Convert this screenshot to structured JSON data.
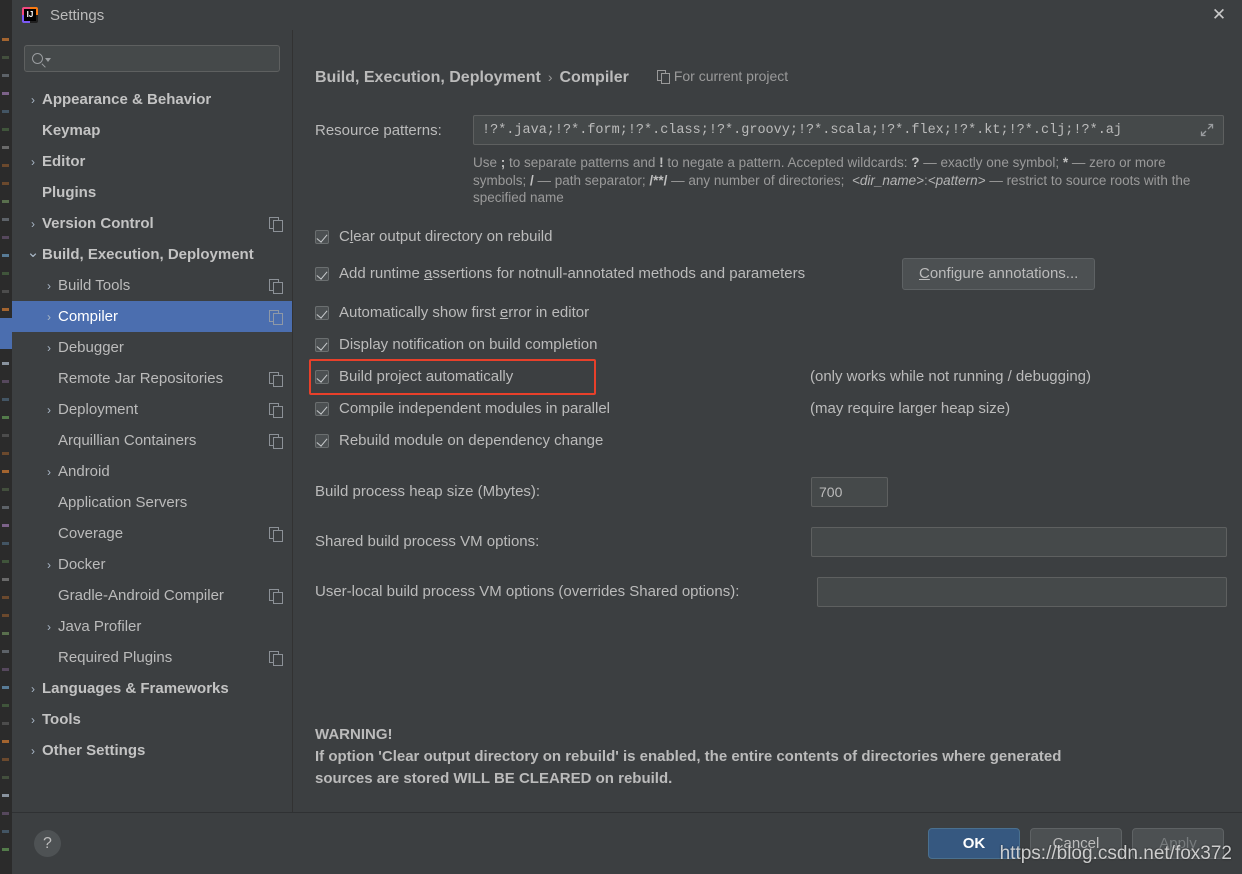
{
  "window": {
    "title": "Settings",
    "app_icon": "intellij-idea-logo",
    "close_label": "✕"
  },
  "sidebar": {
    "search": {
      "placeholder": "",
      "value": "",
      "icon": "search-icon"
    },
    "items": [
      {
        "label": "Appearance & Behavior",
        "arrow": "›",
        "bold": true,
        "indent": 0,
        "copy": false,
        "selected": false
      },
      {
        "label": "Keymap",
        "arrow": "",
        "bold": true,
        "indent": 0,
        "copy": false,
        "selected": false
      },
      {
        "label": "Editor",
        "arrow": "›",
        "bold": true,
        "indent": 0,
        "copy": false,
        "selected": false
      },
      {
        "label": "Plugins",
        "arrow": "",
        "bold": true,
        "indent": 0,
        "copy": false,
        "selected": false
      },
      {
        "label": "Version Control",
        "arrow": "›",
        "bold": true,
        "indent": 0,
        "copy": true,
        "selected": false
      },
      {
        "label": "Build, Execution, Deployment",
        "arrow": "⌄",
        "bold": true,
        "indent": 0,
        "copy": false,
        "selected": false
      },
      {
        "label": "Build Tools",
        "arrow": "›",
        "bold": false,
        "indent": 1,
        "copy": true,
        "selected": false
      },
      {
        "label": "Compiler",
        "arrow": "›",
        "bold": false,
        "indent": 1,
        "copy": true,
        "selected": true
      },
      {
        "label": "Debugger",
        "arrow": "›",
        "bold": false,
        "indent": 1,
        "copy": false,
        "selected": false
      },
      {
        "label": "Remote Jar Repositories",
        "arrow": "",
        "bold": false,
        "indent": 1,
        "copy": true,
        "selected": false
      },
      {
        "label": "Deployment",
        "arrow": "›",
        "bold": false,
        "indent": 1,
        "copy": true,
        "selected": false
      },
      {
        "label": "Arquillian Containers",
        "arrow": "",
        "bold": false,
        "indent": 1,
        "copy": true,
        "selected": false
      },
      {
        "label": "Android",
        "arrow": "›",
        "bold": false,
        "indent": 1,
        "copy": false,
        "selected": false
      },
      {
        "label": "Application Servers",
        "arrow": "",
        "bold": false,
        "indent": 1,
        "copy": false,
        "selected": false
      },
      {
        "label": "Coverage",
        "arrow": "",
        "bold": false,
        "indent": 1,
        "copy": true,
        "selected": false
      },
      {
        "label": "Docker",
        "arrow": "›",
        "bold": false,
        "indent": 1,
        "copy": false,
        "selected": false
      },
      {
        "label": "Gradle-Android Compiler",
        "arrow": "",
        "bold": false,
        "indent": 1,
        "copy": true,
        "selected": false
      },
      {
        "label": "Java Profiler",
        "arrow": "›",
        "bold": false,
        "indent": 1,
        "copy": false,
        "selected": false
      },
      {
        "label": "Required Plugins",
        "arrow": "",
        "bold": false,
        "indent": 1,
        "copy": true,
        "selected": false
      },
      {
        "label": "Languages & Frameworks",
        "arrow": "›",
        "bold": true,
        "indent": 0,
        "copy": false,
        "selected": false
      },
      {
        "label": "Tools",
        "arrow": "›",
        "bold": true,
        "indent": 0,
        "copy": false,
        "selected": false
      },
      {
        "label": "Other Settings",
        "arrow": "›",
        "bold": true,
        "indent": 0,
        "copy": false,
        "selected": false
      }
    ]
  },
  "content": {
    "breadcrumb": {
      "parent": "Build, Execution, Deployment",
      "separator": "›",
      "current": "Compiler",
      "scope": "For current project",
      "scope_icon": "project-scope-icon"
    },
    "resource_patterns": {
      "label": "Resource patterns:",
      "value": "!?*.java;!?*.form;!?*.class;!?*.groovy;!?*.scala;!?*.flex;!?*.kt;!?*.clj;!?*.aj",
      "expand_icon": "expand-editor-icon",
      "hint": "Use ; to separate patterns and ! to negate a pattern. Accepted wildcards: ? — exactly one symbol; * — zero or more symbols; / — path separator; /**/ — any number of directories; <dir_name>:<pattern> — restrict to source roots with the specified name"
    },
    "checkboxes": [
      {
        "label": "Clear output directory on rebuild",
        "checked": true,
        "note": "",
        "mnemonic": "l"
      },
      {
        "label": "Add runtime assertions for notnull-annotated methods and parameters",
        "checked": true,
        "note": "",
        "mnemonic": "a"
      },
      {
        "label": "Automatically show first error in editor",
        "checked": true,
        "note": "",
        "mnemonic": "e"
      },
      {
        "label": "Display notification on build completion",
        "checked": true,
        "note": "",
        "mnemonic": ""
      },
      {
        "label": "Build project automatically",
        "checked": true,
        "note": "(only works while not running / debugging)",
        "mnemonic": "",
        "highlighted": true
      },
      {
        "label": "Compile independent modules in parallel",
        "checked": true,
        "note": "(may require larger heap size)",
        "mnemonic": ""
      },
      {
        "label": "Rebuild module on dependency change",
        "checked": true,
        "note": "",
        "mnemonic": ""
      }
    ],
    "configure_annotations_button": "Configure annotations...",
    "fields": [
      {
        "label": "Build process heap size (Mbytes):",
        "value": "700",
        "placeholder": ""
      },
      {
        "label": "Shared build process VM options:",
        "value": "",
        "placeholder": ""
      },
      {
        "label": "User-local build process VM options (overrides Shared options):",
        "value": "",
        "placeholder": ""
      }
    ],
    "warning": {
      "title": "WARNING!",
      "line1": "If option 'Clear output directory on rebuild' is enabled, the entire contents of directories where generated",
      "line2": "sources are stored WILL BE CLEARED on rebuild."
    }
  },
  "footer": {
    "help_label": "?",
    "help_icon": "help-question-icon",
    "buttons": [
      {
        "label": "OK",
        "style": "primary",
        "enabled": true
      },
      {
        "label": "Cancel",
        "style": "normal",
        "enabled": true
      },
      {
        "label": "Apply",
        "style": "disabled",
        "enabled": false
      }
    ]
  },
  "watermark": "https://blog.csdn.net/fox372",
  "colors": {
    "dialog_bg": "#3c3f41",
    "input_bg": "#45494a",
    "selection_blue": "#4b6eaf",
    "primary_button": "#365880",
    "text": "#bbbbbb",
    "hint_text": "#9a9a9a",
    "highlight_red": "#e8402a"
  }
}
